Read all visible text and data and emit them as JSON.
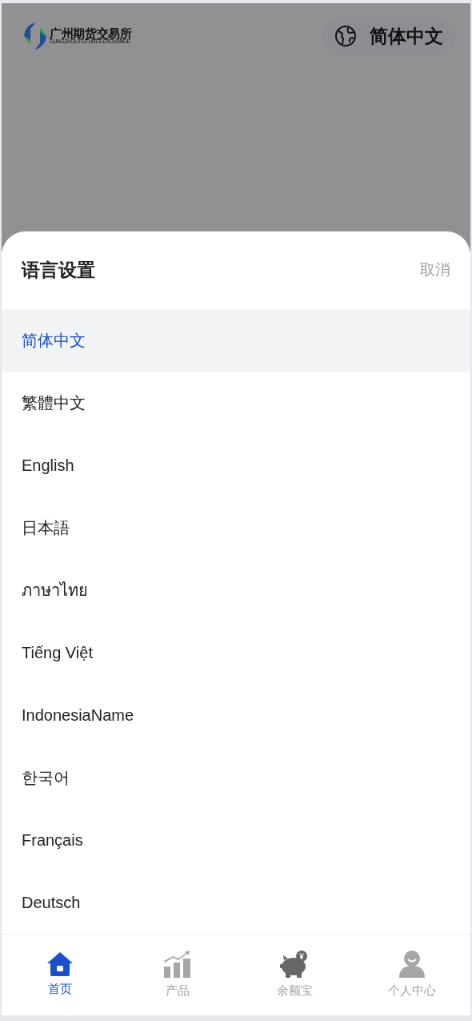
{
  "header": {
    "logo_name": "广州期货交易所",
    "logo_subtitle": "GUNGZHOU FUTURES EXCHANGE",
    "language_button": "简体中文"
  },
  "language_sheet": {
    "title": "语言设置",
    "cancel": "取消",
    "languages": [
      {
        "label": "简体中文",
        "selected": true
      },
      {
        "label": "繁體中文",
        "selected": false
      },
      {
        "label": "English",
        "selected": false
      },
      {
        "label": "日本語",
        "selected": false
      },
      {
        "label": "ภาษาไทย",
        "selected": false
      },
      {
        "label": "Tiếng Việt",
        "selected": false
      },
      {
        "label": "IndonesiaName",
        "selected": false
      },
      {
        "label": "한국어",
        "selected": false
      },
      {
        "label": "Français",
        "selected": false
      },
      {
        "label": "Deutsch",
        "selected": false
      }
    ]
  },
  "bottom_nav": [
    {
      "kind": "home",
      "label": "首页",
      "selected": true
    },
    {
      "kind": "products",
      "label": "产品",
      "selected": false
    },
    {
      "kind": "savings",
      "label": "余额宝",
      "selected": false
    },
    {
      "kind": "profile",
      "label": "个人中心",
      "selected": false
    }
  ]
}
